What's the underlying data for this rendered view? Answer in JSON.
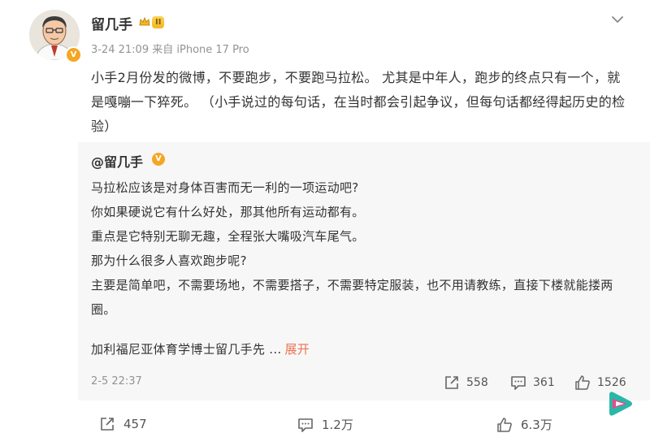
{
  "post": {
    "username": "留几手",
    "level_badge": "II",
    "time": "3-24 21:09",
    "source": "来自 iPhone 17 Pro",
    "text": "小手2月份发的微博，不要跑步，不要跑马拉松。 尤其是中年人，跑步的终点只有一个，就是嘎嘣一下猝死。 （小手说过的每句话，在当时都会引起争议，但每句话都经得起历史的检验）"
  },
  "quote": {
    "username": "@留几手",
    "lines": [
      "马拉松应该是对身体百害而无一利的一项运动吧?",
      "你如果硬说它有什么好处，那其他所有运动都有。",
      "重点是它特别无聊无趣，全程张大嘴吸汽车尾气。",
      "那为什么很多人喜欢跑步呢?",
      "主要是简单吧，不需要场地，不需要搭子，不需要特定服装，也不用请教练，直接下楼就能搂两圈。"
    ],
    "last_line": "加利福尼亚体育学博士留几手先 ...",
    "expand_label": "展开",
    "time": "2-5 22:37",
    "reposts": "558",
    "comments": "361",
    "likes": "1526"
  },
  "stats": {
    "reposts": "457",
    "comments": "1.2万",
    "likes": "6.3万"
  },
  "icons": [
    "chevron-down-icon",
    "repost-icon",
    "comment-icon",
    "like-icon",
    "app-logo-icon"
  ],
  "colors": {
    "accent": "#eb7350",
    "quote_bg": "#f7f7f7",
    "muted": "#939393"
  }
}
